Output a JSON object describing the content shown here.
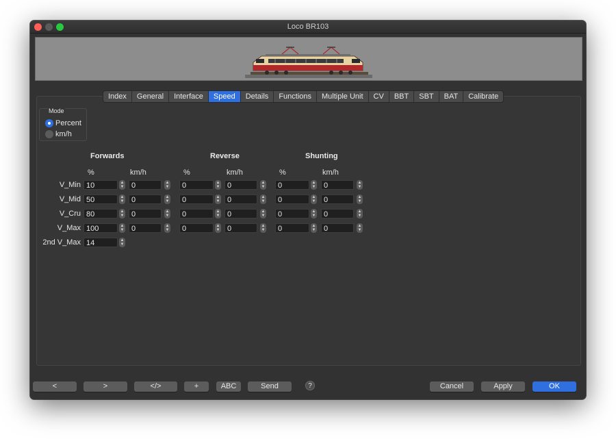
{
  "window": {
    "title": "Loco BR103"
  },
  "banner": {
    "image": "locomotive BR103 electric locomotive photo"
  },
  "tabs": [
    "Index",
    "General",
    "Interface",
    "Speed",
    "Details",
    "Functions",
    "Multiple Unit",
    "CV",
    "BBT",
    "SBT",
    "BAT",
    "Calibrate"
  ],
  "active_tab": "Speed",
  "mode": {
    "title": "Mode",
    "options": [
      {
        "label": "Percent",
        "selected": true
      },
      {
        "label": "km/h",
        "selected": false
      }
    ]
  },
  "groups": {
    "forwards": "Forwards",
    "reverse": "Reverse",
    "shunting": "Shunting"
  },
  "columns": {
    "percent": "%",
    "kmh": "km/h"
  },
  "rows": [
    {
      "label": "V_Min",
      "values": [
        "10",
        "0",
        "0",
        "0",
        "0",
        "0"
      ]
    },
    {
      "label": "V_Mid",
      "values": [
        "50",
        "0",
        "0",
        "0",
        "0",
        "0"
      ]
    },
    {
      "label": "V_Cru",
      "values": [
        "80",
        "0",
        "0",
        "0",
        "0",
        "0"
      ]
    },
    {
      "label": "V_Max",
      "values": [
        "100",
        "0",
        "0",
        "0",
        "0",
        "0"
      ]
    }
  ],
  "second_vmax": {
    "label": "2nd V_Max",
    "value": "14"
  },
  "buttons": {
    "prev": "<",
    "next": ">",
    "code": "</>",
    "add": "+",
    "abc": "ABC",
    "send": "Send",
    "help": "?",
    "cancel": "Cancel",
    "apply": "Apply",
    "ok": "OK"
  },
  "colors": {
    "accent": "#2f6fe0",
    "window_bg": "#323232",
    "close": "#fe5f57",
    "zoom": "#28c840"
  }
}
